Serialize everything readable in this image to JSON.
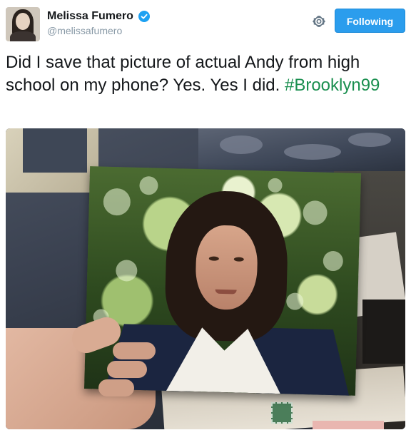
{
  "author": {
    "display_name": "Melissa Fumero",
    "handle": "@melissafumero",
    "verified": true,
    "avatar_icon": "profile-photo"
  },
  "actions": {
    "settings_icon": "gear-icon",
    "follow_button_label": "Following"
  },
  "tweet": {
    "text": "Did I save that picture of actual Andy from high school on my phone? Yes. Yes I did. ",
    "hashtag": "#Brooklyn99"
  },
  "colors": {
    "follow_button": "#2b9ded",
    "hashtag": "#1a8f4f",
    "verified_badge": "#1da1f2",
    "handle": "#8899a6"
  }
}
